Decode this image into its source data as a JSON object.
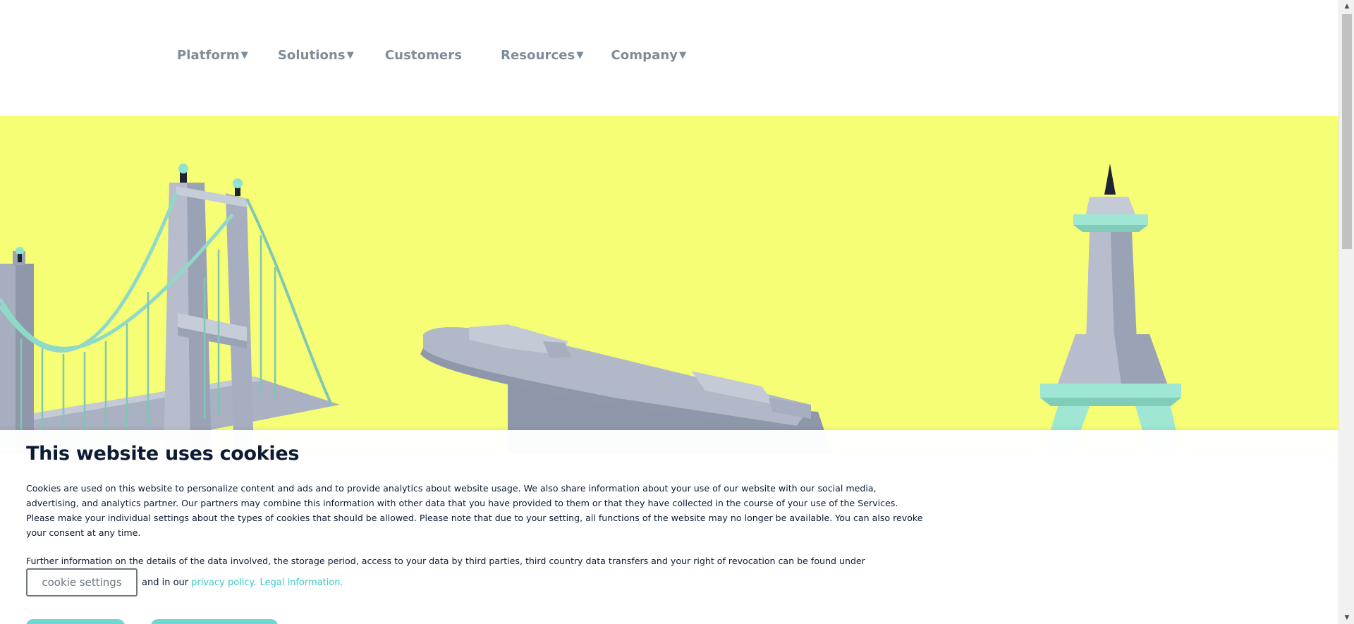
{
  "nav": {
    "items": [
      {
        "label": "Platform",
        "caret": "▼"
      },
      {
        "label": "Solutions",
        "caret": "▼"
      },
      {
        "label": "Customers",
        "caret": ""
      },
      {
        "label": "Resources",
        "caret": "▼"
      },
      {
        "label": "Company",
        "caret": "▼"
      }
    ]
  },
  "hero": {
    "background": "#f6fe76",
    "illustration_objects": [
      "suspension-bridge",
      "ship",
      "eiffel-tower"
    ]
  },
  "cookie": {
    "title": "This website uses cookies",
    "body": "Cookies are used on this website to personalize content and ads and to provide analytics about website usage. We also share information about your use of our website with our social media, advertising, and analytics partner. Our partners may combine this information with other data that you have provided to them or that they have collected in the course of your use of the Services. Please make your individual settings about the types of cookies that should be allowed. Please note that due to your setting, all functions of the website may no longer be available. You can also revoke your consent at any time.",
    "further": "Further information on the details of the data involved, the storage period, access to your data by third parties, third country data transfers and your right of revocation can be found under",
    "settings_button": "cookie settings",
    "and_in_our": "and in our",
    "privacy_link": "privacy policy.",
    "legal_link": "Legal information."
  },
  "colors": {
    "accent": "#3dc9c1",
    "title": "#0c1b33",
    "nav": "#7e8c99"
  }
}
